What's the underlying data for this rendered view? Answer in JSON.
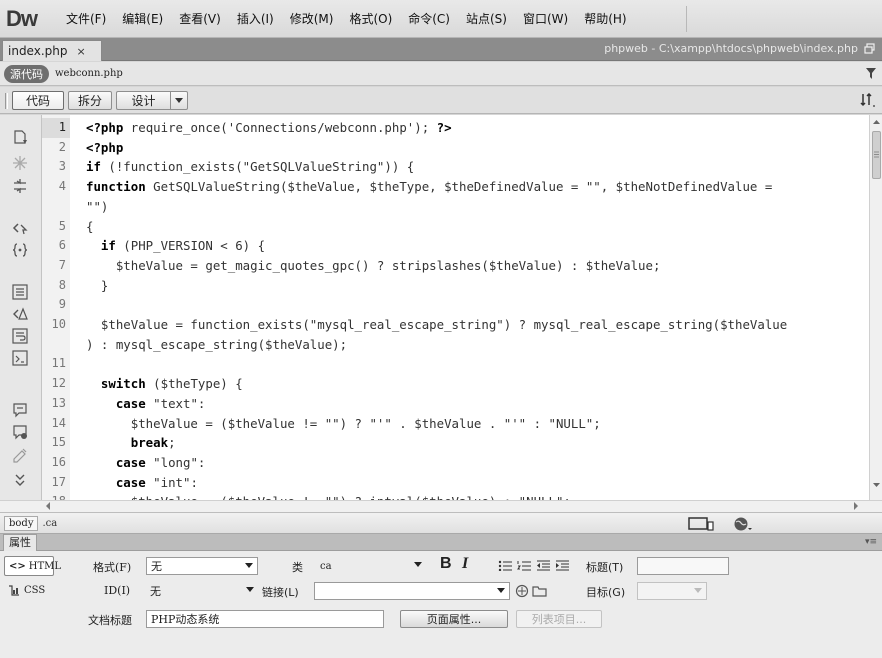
{
  "app": {
    "logo": "Dw",
    "menu": [
      "文件(F)",
      "编辑(E)",
      "查看(V)",
      "插入(I)",
      "修改(M)",
      "格式(O)",
      "命令(C)",
      "站点(S)",
      "窗口(W)",
      "帮助(H)"
    ]
  },
  "doc_tab": {
    "filename": "index.php",
    "close": "×",
    "path": "phpweb - C:\\xampp\\htdocs\\phpweb\\index.php"
  },
  "related": {
    "source_label": "源代码",
    "file": "webconn.php"
  },
  "view_toolbar": {
    "code": "代码",
    "split": "拆分",
    "design": "设计"
  },
  "code": {
    "current_line": 1,
    "lines": [
      {
        "num": "1",
        "text": "<?php require_once('Connections/webconn.php'); ?>"
      },
      {
        "num": "2",
        "text": "<?php"
      },
      {
        "num": "3",
        "text": "if (!function_exists(\"GetSQLValueString\")) {"
      },
      {
        "num": "4",
        "text": "function GetSQLValueString($theValue, $theType, $theDefinedValue = \"\", $theNotDefinedValue ="
      },
      {
        "num": "",
        "text": "\"\")"
      },
      {
        "num": "5",
        "text": "{"
      },
      {
        "num": "6",
        "text": "  if (PHP_VERSION < 6) {"
      },
      {
        "num": "7",
        "text": "    $theValue = get_magic_quotes_gpc() ? stripslashes($theValue) : $theValue;"
      },
      {
        "num": "8",
        "text": "  }"
      },
      {
        "num": "9",
        "text": ""
      },
      {
        "num": "10",
        "text": "  $theValue = function_exists(\"mysql_real_escape_string\") ? mysql_real_escape_string($theValue"
      },
      {
        "num": "",
        "text": ") : mysql_escape_string($theValue);"
      },
      {
        "num": "11",
        "text": ""
      },
      {
        "num": "12",
        "text": "  switch ($theType) {"
      },
      {
        "num": "13",
        "text": "    case \"text\":"
      },
      {
        "num": "14",
        "text": "      $theValue = ($theValue != \"\") ? \"'\" . $theValue . \"'\" : \"NULL\";"
      },
      {
        "num": "15",
        "text": "      break;"
      },
      {
        "num": "16",
        "text": "    case \"long\":"
      },
      {
        "num": "17",
        "text": "    case \"int\":"
      },
      {
        "num": "18",
        "text": "      $theValue = ($theValue != \"\") ? intval($theValue) : \"NULL\";"
      }
    ]
  },
  "status": {
    "tag_body": "body",
    "tag_class": ".ca"
  },
  "properties": {
    "title": "属性",
    "html_btn": "HTML",
    "css_btn": "CSS",
    "format_label": "格式(F)",
    "format_value": "无",
    "class_label": "类",
    "class_value": "ca",
    "bold": "B",
    "italic": "I",
    "heading_label": "标题(T)",
    "id_label": "ID(I)",
    "id_value": "无",
    "link_label": "链接(L)",
    "link_value": "",
    "target_label": "目标(G)",
    "doc_title_label": "文档标题",
    "doc_title_value": "PHP动态系统",
    "page_props_btn": "页面属性...",
    "list_item_btn": "列表项目..."
  }
}
